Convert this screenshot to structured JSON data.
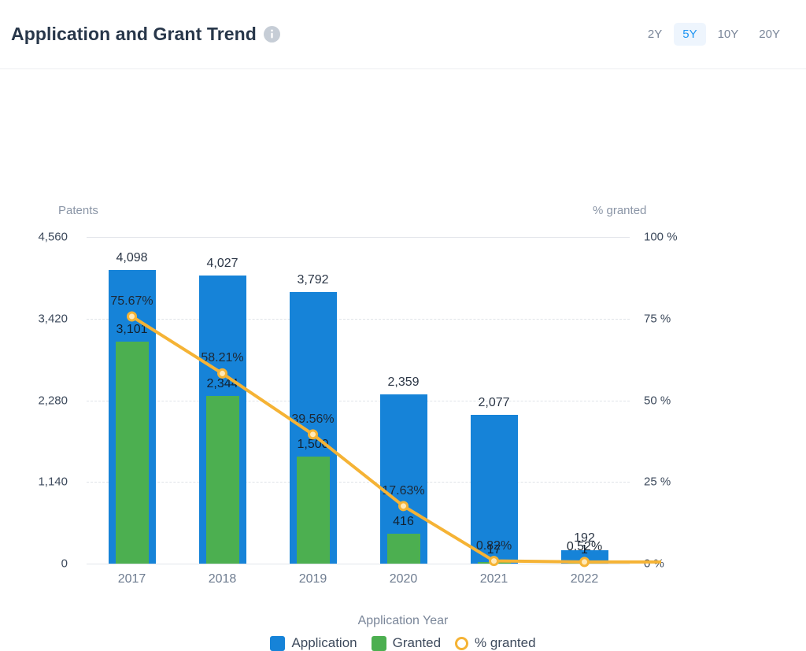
{
  "header": {
    "title": "Application and Grant Trend",
    "info_icon": "info-icon",
    "ranges": [
      {
        "label": "2Y",
        "active": false
      },
      {
        "label": "5Y",
        "active": true
      },
      {
        "label": "10Y",
        "active": false
      },
      {
        "label": "20Y",
        "active": false
      }
    ]
  },
  "chart_data": {
    "type": "bar",
    "title": "Application and Grant Trend",
    "categories": [
      "2017",
      "2018",
      "2019",
      "2020",
      "2021",
      "2022"
    ],
    "xlabel": "Application Year",
    "ylabel": "Patents",
    "y2label": "% granted",
    "ylim": [
      0,
      4560
    ],
    "y2lim": [
      0,
      100
    ],
    "yticks": [
      "0",
      "1,140",
      "2,280",
      "3,420",
      "4,560"
    ],
    "ytick_values": [
      0,
      1140,
      2280,
      3420,
      4560
    ],
    "y2ticks": [
      "0 %",
      "25 %",
      "50 %",
      "75 %",
      "100 %"
    ],
    "y2tick_values": [
      0,
      25,
      50,
      75,
      100
    ],
    "grid": true,
    "legend_position": "bottom",
    "series": [
      {
        "name": "Application",
        "type": "bar",
        "color": "#1683d8",
        "values": [
          4098,
          4027,
          3792,
          2359,
          2077,
          192
        ],
        "labels": [
          "4,098",
          "4,027",
          "3,792",
          "2,359",
          "2,077",
          "192"
        ]
      },
      {
        "name": "Granted",
        "type": "bar",
        "color": "#4caf50",
        "values": [
          3101,
          2344,
          1500,
          416,
          17,
          1
        ],
        "labels": [
          "3,101",
          "2,344",
          "1,500",
          "416",
          "17",
          "1"
        ]
      },
      {
        "name": "% granted",
        "type": "line",
        "color": "#f5b335",
        "axis": "right",
        "values": [
          75.67,
          58.21,
          39.56,
          17.63,
          0.82,
          0.52
        ],
        "labels": [
          "75.67%",
          "58.21%",
          "39.56%",
          "17.63%",
          "0.82%",
          "0.52%"
        ]
      }
    ]
  }
}
